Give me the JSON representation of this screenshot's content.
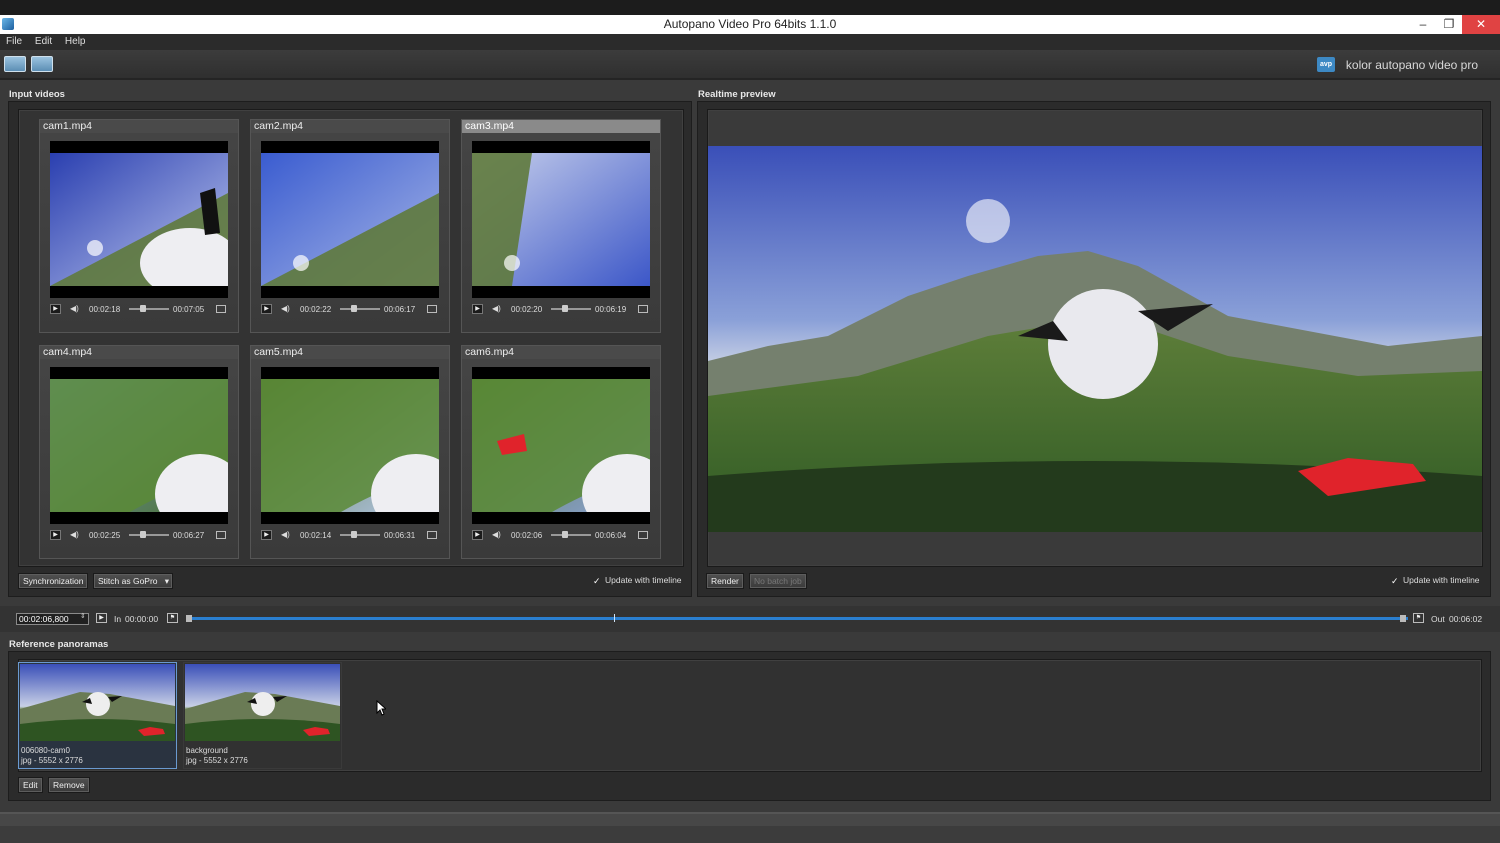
{
  "window": {
    "title": "Autopano Video Pro 64bits 1.1.0",
    "minimize": "–",
    "restore": "❐",
    "close": "✕"
  },
  "menu": [
    "File",
    "Edit",
    "Help"
  ],
  "brand": {
    "logo": "avp",
    "text": "kolor autopano video pro"
  },
  "input_videos": {
    "title": "Input videos",
    "videos": [
      {
        "name": "cam1.mp4",
        "current": "00:02:18",
        "duration": "00:07:05",
        "selected": false
      },
      {
        "name": "cam2.mp4",
        "current": "00:02:22",
        "duration": "00:06:17",
        "selected": false
      },
      {
        "name": "cam3.mp4",
        "current": "00:02:20",
        "duration": "00:06:19",
        "selected": true
      },
      {
        "name": "cam4.mp4",
        "current": "00:02:25",
        "duration": "00:06:27",
        "selected": false
      },
      {
        "name": "cam5.mp4",
        "current": "00:02:14",
        "duration": "00:06:31",
        "selected": false
      },
      {
        "name": "cam6.mp4",
        "current": "00:02:06",
        "duration": "00:06:04",
        "selected": false
      }
    ],
    "synchronization_label": "Synchronization",
    "stitch_label": "Stitch  as GoPro",
    "update_label": "Update with timeline",
    "update_checked": true
  },
  "preview": {
    "title": "Realtime preview",
    "render_label": "Render",
    "batch_label": "No batch job",
    "update_label": "Update with timeline",
    "update_checked": true
  },
  "timeline": {
    "timecode": "00:02:06,800",
    "in_label": "In",
    "in_time": "00:00:00",
    "out_label": "Out",
    "out_time": "00:06:02",
    "position_fraction": 0.35
  },
  "reference_panoramas": {
    "title": "Reference panoramas",
    "items": [
      {
        "name": "006080-cam0",
        "info": "jpg - 5552 x 2776",
        "selected": true
      },
      {
        "name": "background",
        "info": "jpg - 5552 x 2776",
        "selected": false
      }
    ],
    "edit_label": "Edit",
    "remove_label": "Remove"
  },
  "icons": {
    "play": "play-icon",
    "mute": "speaker-icon",
    "fullscreen": "grid-icon",
    "check": "checkmark-icon"
  },
  "colors": {
    "accent": "#2a7fd0",
    "close": "#e04343"
  }
}
